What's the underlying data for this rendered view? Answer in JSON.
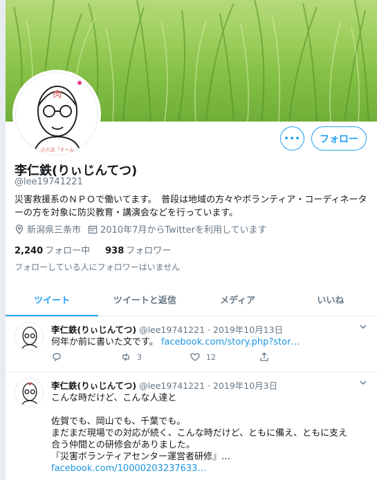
{
  "profile": {
    "name": "李仁鉄(りぃじんてつ)",
    "handle": "@lee19741221",
    "bio": "災害救援系のＮＰＯで働いてます。　普段は地域の方々やボランティア・コーディネーターの方を対象に防災教育・講演会などを行っています。",
    "location": "新潟県三条市",
    "joined": "2010年7月からTwitterを利用しています",
    "following_count": "2,240",
    "following_label": "フォロー中",
    "followers_count": "938",
    "followers_label": "フォロワー",
    "followers_note": "フォローしている人にフォロワーはいません",
    "avatar_text": "肉",
    "avatar_caption": "小人災「チーム"
  },
  "buttons": {
    "more": "•••",
    "follow": "フォロー"
  },
  "tabs": [
    {
      "label": "ツイート",
      "active": true
    },
    {
      "label": "ツイートと返信",
      "active": false
    },
    {
      "label": "メディア",
      "active": false
    },
    {
      "label": "いいね",
      "active": false
    }
  ],
  "tweets": [
    {
      "name": "李仁鉄(りぃじんてつ)",
      "meta": "@lee19741221 · 2019年10月13日",
      "text": "何年か前に書いた文です。",
      "link": "facebook.com/story.php?stor…",
      "retweets": "3",
      "likes": "12"
    },
    {
      "name": "李仁鉄(りぃじんてつ)",
      "meta": "@lee19741221 · 2019年10月3日",
      "lines": [
        "こんな時だけど、こんな人達と",
        "",
        "佐賀でも、岡山でも、千葉でも。",
        "まだまだ現場での対応が続く、こんな時だけど、ともに備え、ともに支え",
        "合う仲間との研修会がありました。",
        "『災害ボランティアセンター運営者研修』…"
      ],
      "link": "facebook.com/1000020323763​3…"
    }
  ],
  "colors": {
    "accent": "#1da1f2",
    "secondary_text": "#657786"
  }
}
